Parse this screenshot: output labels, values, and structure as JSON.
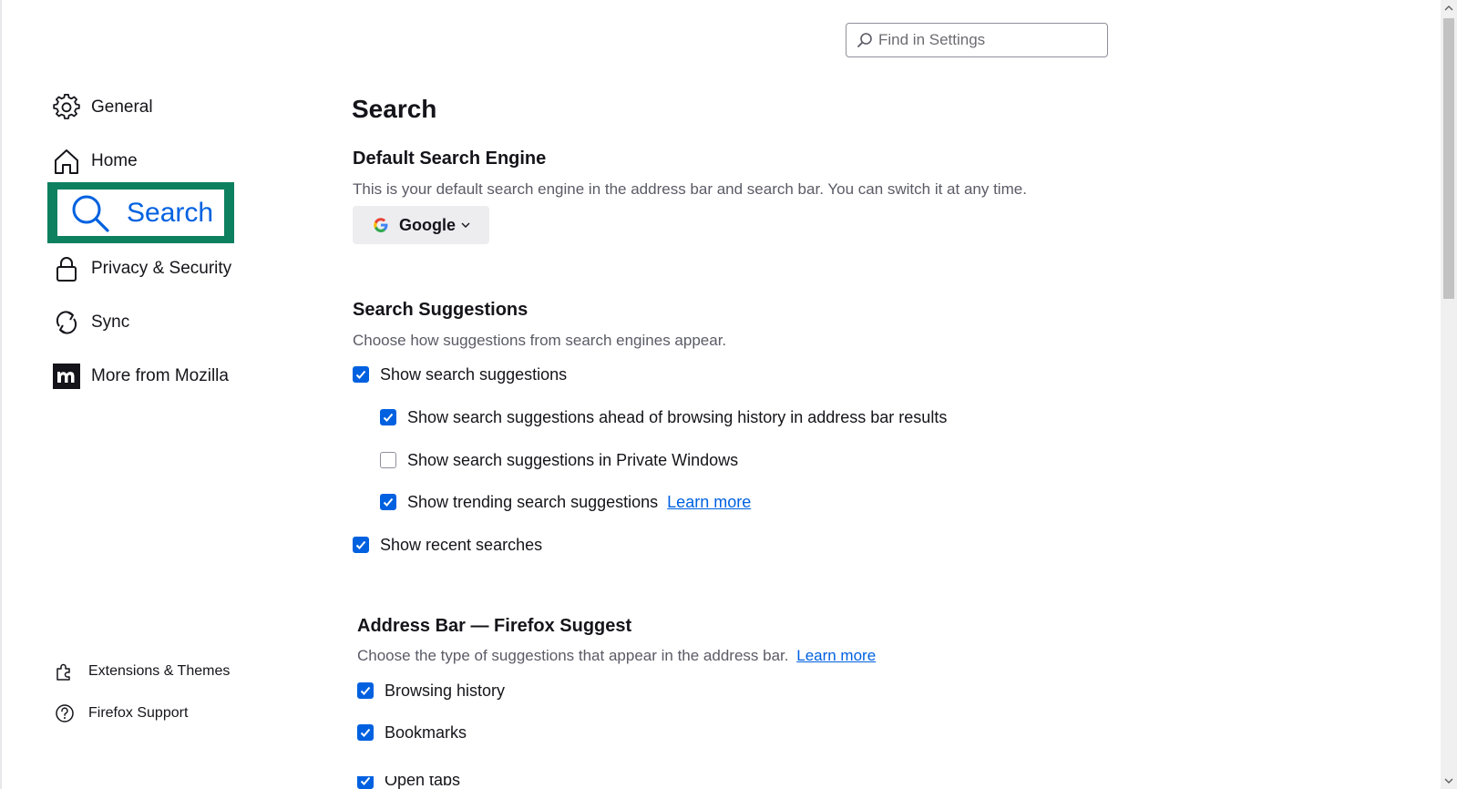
{
  "search": {
    "placeholder": "Find in Settings"
  },
  "sidebar": {
    "items": [
      {
        "label": "General",
        "icon": "gear-icon"
      },
      {
        "label": "Home",
        "icon": "home-icon"
      },
      {
        "label": "Search",
        "icon": "search-icon",
        "selected": true
      },
      {
        "label": "Privacy & Security",
        "icon": "lock-icon"
      },
      {
        "label": "Sync",
        "icon": "sync-icon"
      },
      {
        "label": "More from Mozilla",
        "icon": "mozilla-logo-icon"
      }
    ],
    "footer": [
      {
        "label": "Extensions & Themes",
        "icon": "puzzle-icon"
      },
      {
        "label": "Firefox Support",
        "icon": "help-icon"
      }
    ],
    "selected_outline_color": "#0d8060"
  },
  "main": {
    "title": "Search",
    "default_engine": {
      "heading": "Default Search Engine",
      "description": "This is your default search engine in the address bar and search bar. You can switch it at any time.",
      "selected_engine": "Google"
    },
    "suggestions": {
      "heading": "Search Suggestions",
      "description": "Choose how suggestions from search engines appear.",
      "options": [
        {
          "label": "Show search suggestions",
          "checked": true
        },
        {
          "label": "Show search suggestions ahead of browsing history in address bar results",
          "checked": true
        },
        {
          "label": "Show search suggestions in Private Windows",
          "checked": false
        },
        {
          "label": "Show trending search suggestions",
          "checked": true,
          "link": "Learn more"
        },
        {
          "label": "Show recent searches",
          "checked": true
        }
      ]
    },
    "address_bar": {
      "heading": "Address Bar — Firefox Suggest",
      "description": "Choose the type of suggestions that appear in the address bar.",
      "link": "Learn more",
      "options": [
        {
          "label": "Browsing history",
          "checked": true
        },
        {
          "label": "Bookmarks",
          "checked": true
        },
        {
          "label": "Open tabs",
          "checked": true
        }
      ]
    }
  },
  "colors": {
    "accent": "#0061e0",
    "text": "#15141a",
    "secondary_text": "#5b5b66"
  }
}
